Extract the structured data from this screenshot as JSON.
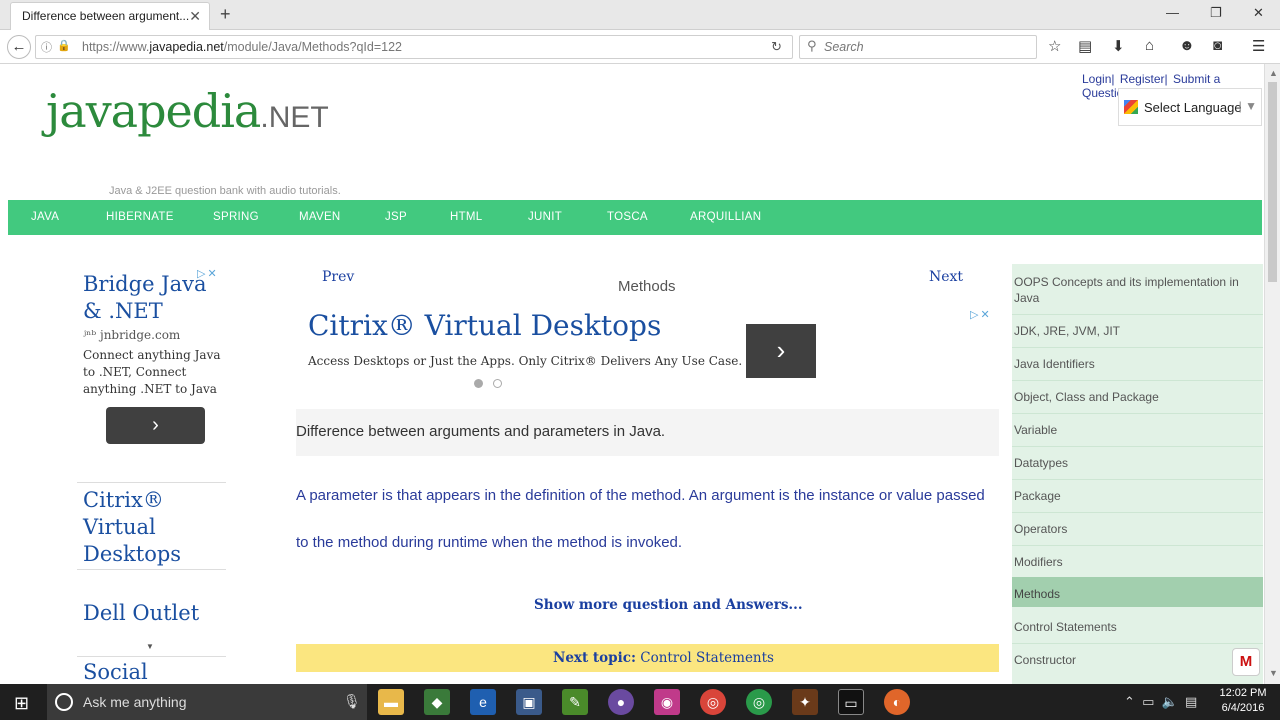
{
  "browser": {
    "tab_title": "Difference between argument...",
    "url_prefix": "https://www.",
    "url_domain": "javapedia.net",
    "url_path": "/module/Java/Methods?qId=122",
    "search_placeholder": "Search"
  },
  "site": {
    "logo_main": "javapedia",
    "logo_suffix": ".NET",
    "tagline": "Java & J2EE question bank with audio tutorials.",
    "top_links": [
      "Login|",
      "Register|",
      "Submit a Question"
    ],
    "language_select": "Select Language",
    "menu": [
      "JAVA",
      "HIBERNATE",
      "SPRING",
      "MAVEN",
      "JSP",
      "HTML",
      "JUNIT",
      "TOSCA",
      "ARQUILLIAN"
    ]
  },
  "left_ads": {
    "title": "Bridge Java & .NET",
    "domain": "jnbridge.com",
    "text": "Connect anything Java to .NET, Connect anything .NET to Java",
    "links": [
      "Citrix® Virtual Desktops",
      "Dell Outlet",
      "Social"
    ]
  },
  "center": {
    "prev": "Prev",
    "next": "Next",
    "title": "Methods",
    "ad_title": "Citrix® Virtual Desktops",
    "ad_text": "Access Desktops or Just the Apps. Only Citrix® Delivers Any Use Case.",
    "question": "Difference between arguments and parameters in Java.",
    "answer": "A parameter is that appears in the definition of the method. An argument is the instance or value passed to the method during runtime when the method is invoked.",
    "show_more": "Show more question and Answers...",
    "next_topic_label": "Next topic:",
    "next_topic_value": "Control Statements"
  },
  "sidebar": {
    "items": [
      "OOPS Concepts and its implementation in Java",
      "JDK, JRE, JVM, JIT",
      "Java Identifiers",
      "Object, Class and Package",
      "Variable",
      "Datatypes",
      "Package",
      "Operators",
      "Modifiers",
      "Methods",
      "Control Statements",
      "Constructor"
    ],
    "active": "Methods"
  },
  "taskbar": {
    "search_text": "Ask me anything",
    "time": "12:02 PM",
    "date": "6/4/2016"
  },
  "colors": {
    "menu_bar": "#42c97f",
    "sidebar_bg": "#e2f2e6",
    "sidebar_active": "#a2cfae",
    "next_topic_bg": "#fbe680",
    "link_blue": "#1a3fa0"
  }
}
